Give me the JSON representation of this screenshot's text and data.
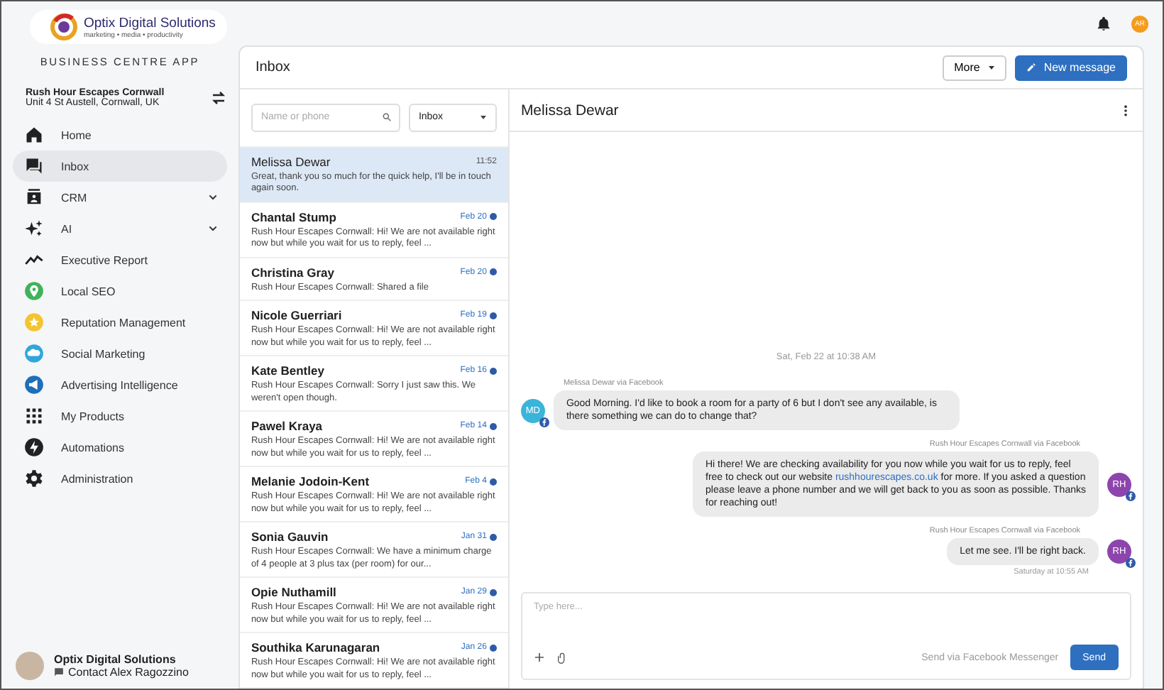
{
  "brand": {
    "name": "Optix Digital Solutions",
    "tagline": "marketing • media • productivity",
    "app": "BUSINESS CENTRE APP"
  },
  "account": {
    "name": "Rush Hour Escapes Cornwall",
    "address": "Unit 4 St Austell, Cornwall, UK"
  },
  "nav": [
    {
      "label": "Home",
      "selected": false,
      "has_submenu": false
    },
    {
      "label": "Inbox",
      "selected": true,
      "has_submenu": false
    },
    {
      "label": "CRM",
      "selected": false,
      "has_submenu": true
    },
    {
      "label": "AI",
      "selected": false,
      "has_submenu": true
    },
    {
      "label": "Executive Report",
      "selected": false,
      "has_submenu": false
    },
    {
      "label": "Local SEO",
      "selected": false,
      "has_submenu": false
    },
    {
      "label": "Reputation Management",
      "selected": false,
      "has_submenu": false
    },
    {
      "label": "Social Marketing",
      "selected": false,
      "has_submenu": false
    },
    {
      "label": "Advertising Intelligence",
      "selected": false,
      "has_submenu": false
    },
    {
      "label": "My Products",
      "selected": false,
      "has_submenu": false
    },
    {
      "label": "Automations",
      "selected": false,
      "has_submenu": false
    },
    {
      "label": "Administration",
      "selected": false,
      "has_submenu": false
    }
  ],
  "footer": {
    "name": "Optix Digital Solutions",
    "contact": "Contact Alex Ragozzino"
  },
  "topbar": {
    "user_initials": "AR"
  },
  "inbox": {
    "title": "Inbox",
    "more_button": "More",
    "new_button": "New message",
    "search": {
      "placeholder": "Name or phone"
    },
    "filter": "Inbox"
  },
  "conversations": [
    {
      "name": "Melissa Dewar",
      "time": "11:52",
      "preview": "Great, thank you so much for the quick help, I'll be in touch again soon.",
      "selected": true
    },
    {
      "name": "Chantal Stump",
      "time": "Feb 20",
      "preview": "Rush Hour Escapes Cornwall: Hi! We are not available right now but while you wait for us to reply, feel ...",
      "selected": false
    },
    {
      "name": "Christina Gray",
      "time": "Feb 20",
      "preview": "Rush Hour Escapes Cornwall: Shared a file",
      "selected": false
    },
    {
      "name": "Nicole Guerriari",
      "time": "Feb 19",
      "preview": "Rush Hour Escapes Cornwall: Hi! We are not available right now but while you wait for us to reply, feel ...",
      "selected": false
    },
    {
      "name": "Kate Bentley",
      "time": "Feb 16",
      "preview": "Rush Hour Escapes Cornwall: Sorry I just saw this. We weren't open though.",
      "selected": false
    },
    {
      "name": "Pawel Kraya",
      "time": "Feb 14",
      "preview": "Rush Hour Escapes Cornwall: Hi! We are not available right now but while you wait for us to reply, feel ...",
      "selected": false
    },
    {
      "name": "Melanie Jodoin-Kent",
      "time": "Feb 4",
      "preview": "Rush Hour Escapes Cornwall: Hi! We are not available right now but while you wait for us to reply, feel ...",
      "selected": false
    },
    {
      "name": "Sonia Gauvin",
      "time": "Jan 31",
      "preview": "Rush Hour Escapes Cornwall: We have a minimum charge of 4 people at 3 plus tax (per room) for our...",
      "selected": false
    },
    {
      "name": "Opie Nuthamill",
      "time": "Jan 29",
      "preview": "Rush Hour Escapes Cornwall: Hi! We are not available right now but while you wait for us to reply, feel ...",
      "selected": false
    },
    {
      "name": "Southika Karunagaran",
      "time": "Jan 26",
      "preview": "Rush Hour Escapes Cornwall: Hi! We are not available right now but while you wait for us to reply, feel ...",
      "selected": false
    }
  ],
  "chat": {
    "title": "Melissa Dewar",
    "day_divider": "Sat, Feb 22 at 10:38 AM",
    "messages": [
      {
        "kind": "incoming",
        "sender": "Melissa Dewar",
        "via": "via Facebook",
        "initials": "MD",
        "parts": [
          {
            "text": "Good Morning. I'd like to book a room for a party of 6 but I don't see any available, is there something we can do to change that?"
          }
        ]
      },
      {
        "kind": "outgoing",
        "sender": "Rush Hour Escapes Cornwall",
        "via": "via Facebook",
        "initials": "RH",
        "parts": [
          {
            "text": "Hi there! We are checking availability for you now while you wait for us to reply, feel free to check out our website "
          },
          {
            "text": "rushhourescapes.co.uk",
            "link": true
          },
          {
            "text": " for more. If you asked a question please leave a phone number and we will get back to you as soon as possible. Thanks for reaching out!"
          }
        ]
      },
      {
        "kind": "outgoing",
        "sender": "Rush Hour Escapes Cornwall",
        "via": "via Facebook",
        "initials": "RH",
        "parts": [
          {
            "text": "Let me see. I'll be right back."
          }
        ],
        "time": "Saturday at 10:55 AM"
      }
    ],
    "composer": {
      "placeholder": "Type here...",
      "channel": "Send via Facebook Messenger",
      "send_button": "Send"
    }
  }
}
